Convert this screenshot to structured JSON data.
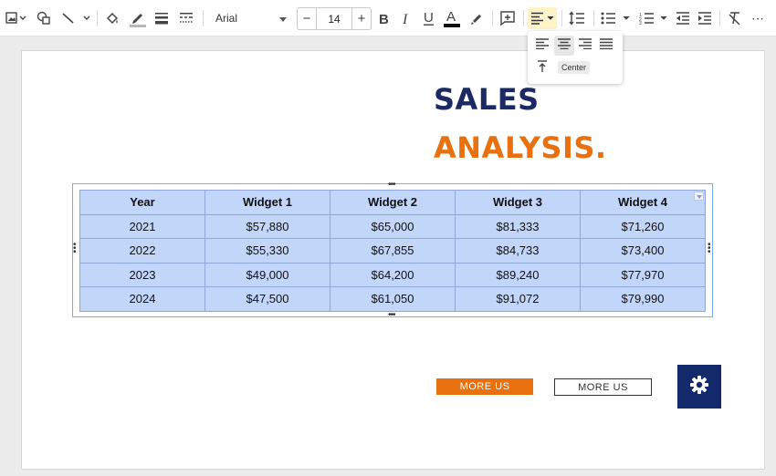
{
  "toolbar": {
    "font": "Arial",
    "font_size": "14",
    "decrease_label": "−",
    "increase_label": "+",
    "more_label": "⋯"
  },
  "align_popup": {
    "tooltip": "Center",
    "options": [
      "align-left",
      "align-center",
      "align-right",
      "justify",
      "align-top",
      "align-middle"
    ]
  },
  "slide": {
    "title_line1": "SALES",
    "title_line2": "ANALYSIS.",
    "button1": "MORE US",
    "button2": "MORE US",
    "colors": {
      "navy": "#1b2a63",
      "orange": "#e8700e",
      "table_fill": "#c2d6fa",
      "gear_box": "#12296b"
    }
  },
  "table": {
    "headers": [
      "Year",
      "Widget 1",
      "Widget 2",
      "Widget 3",
      "Widget 4"
    ],
    "rows": [
      [
        "2021",
        "$57,880",
        "$65,000",
        "$81,333",
        "$71,260"
      ],
      [
        "2022",
        "$55,330",
        "$67,855",
        "$84,733",
        "$73,400"
      ],
      [
        "2023",
        "$49,000",
        "$64,200",
        "$89,240",
        "$77,970"
      ],
      [
        "2024",
        "$47,500",
        "$61,050",
        "$91,072",
        "$79,990"
      ]
    ]
  }
}
